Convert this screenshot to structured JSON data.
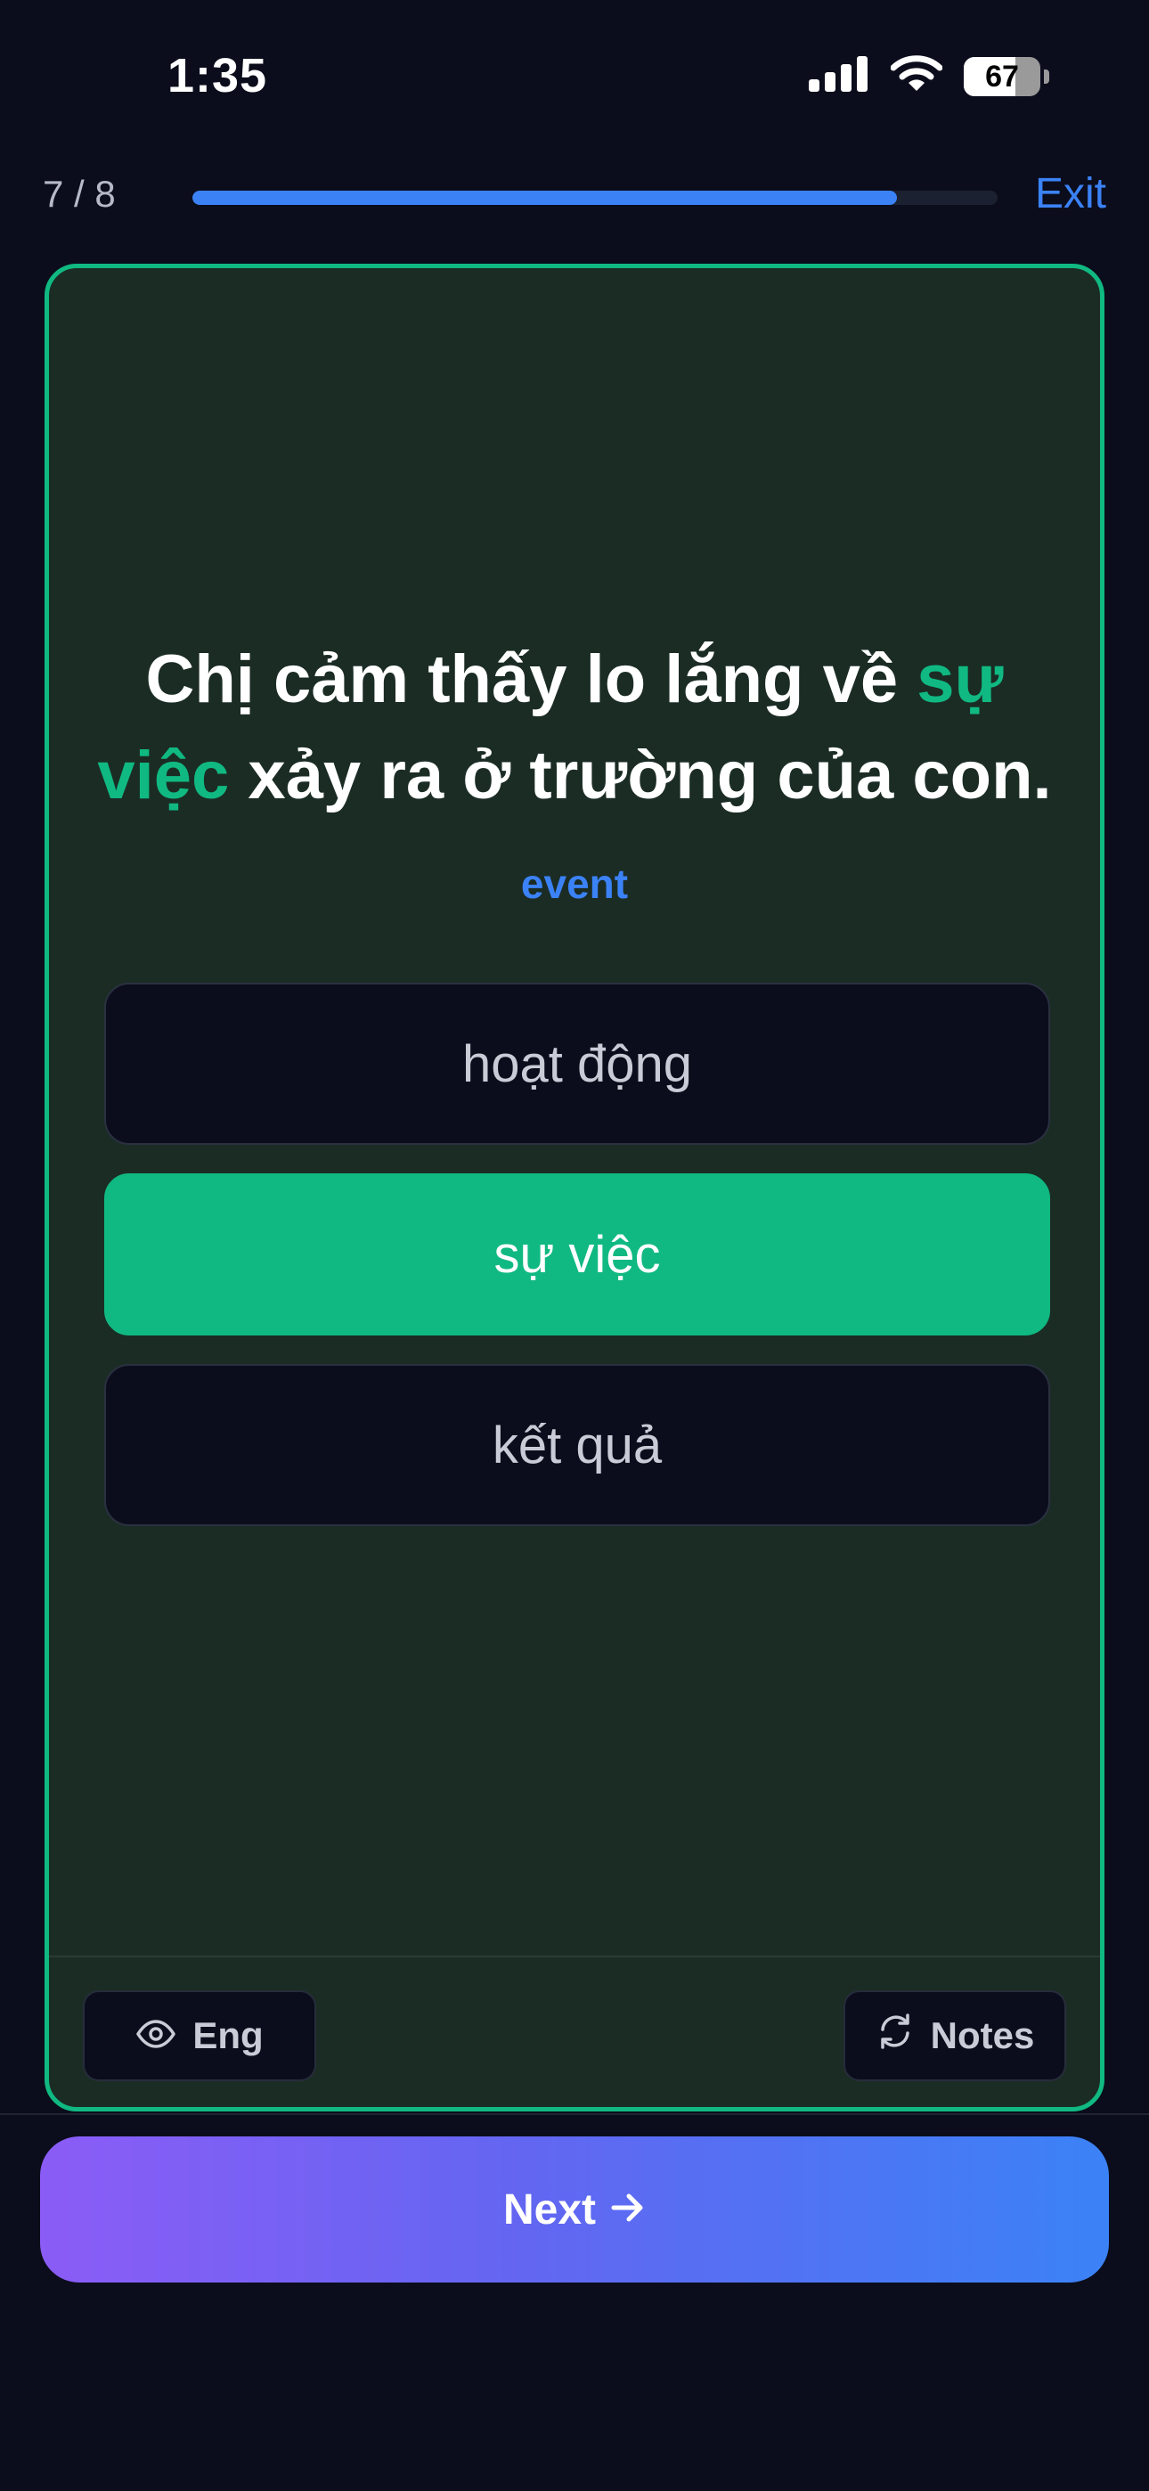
{
  "status_bar": {
    "time": "1:35",
    "battery": "67",
    "battery_level": 0.67,
    "icons": [
      "signal-icon",
      "wifi-icon",
      "battery-icon"
    ]
  },
  "header": {
    "progress_text": "7 / 8",
    "progress_fraction": 0.875,
    "exit_label": "Exit"
  },
  "question": {
    "before": "Chị cảm thấy lo lắng về ",
    "highlight": "sự việc",
    "after": " xảy ra ở trường của con.",
    "hint": "event"
  },
  "options": [
    {
      "label": "hoạt động",
      "selected": false
    },
    {
      "label": "sự việc",
      "selected": true
    },
    {
      "label": "kết quả",
      "selected": false
    }
  ],
  "tools": {
    "eng_label": "Eng",
    "notes_label": "Notes"
  },
  "next": {
    "label": "Next"
  },
  "colors": {
    "background": "#0b0d1c",
    "card": "#1b2c25",
    "accent_green": "#10b981",
    "accent_blue": "#3b82f6",
    "gradient_start": "#8b5cf6"
  }
}
